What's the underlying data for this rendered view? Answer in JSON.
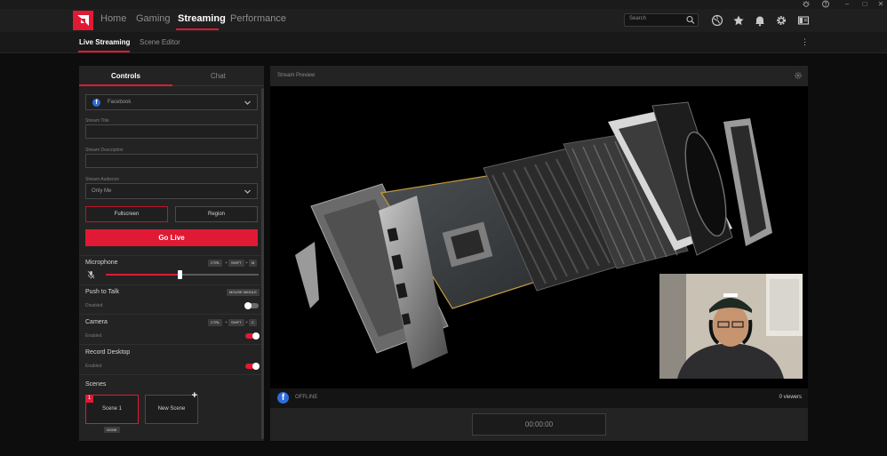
{
  "colors": {
    "accent": "#e01a34",
    "panel": "#232323",
    "background": "#0d0d0d",
    "facebook": "#2d6bd9"
  },
  "window": {
    "icons": [
      "bug-icon",
      "help-icon",
      "minimize-icon",
      "maximize-icon",
      "close-icon"
    ],
    "glyphs": {
      "minimize": "–",
      "maximize": "□",
      "close": "✕"
    }
  },
  "header": {
    "nav": [
      "Home",
      "Gaming",
      "Streaming",
      "Performance"
    ],
    "active": "Streaming",
    "search_placeholder": "Search",
    "icons": [
      "globe-icon",
      "star-icon",
      "bell-icon",
      "gear-icon",
      "panel-icon"
    ]
  },
  "subnav": {
    "tabs": [
      "Live Streaming",
      "Scene Editor"
    ],
    "active": "Live Streaming",
    "more": "⋮"
  },
  "left": {
    "tabs": [
      "Controls",
      "Chat"
    ],
    "platform": "Facebook",
    "platform_glyph": "f",
    "stream_title_label": "Stream Title",
    "stream_description_label": "Stream Description",
    "stream_audience_label": "Stream Audience",
    "stream_audience_value": "Only Me",
    "capture_buttons": [
      "Fullscreen",
      "Region"
    ],
    "go_live": "Go Live",
    "microphone": {
      "label": "Microphone",
      "keys": [
        "CTRL",
        "SHIFT",
        "M"
      ],
      "level": 0.48
    },
    "push_to_talk": {
      "label": "Push to Talk",
      "key": "MOUSE MIDDLE",
      "status": "Disabled",
      "on": false
    },
    "camera": {
      "label": "Camera",
      "keys": [
        "CTRL",
        "SHIFT",
        "C"
      ],
      "status": "Enabled",
      "on": true
    },
    "record_desktop": {
      "label": "Record Desktop",
      "status": "Enabled",
      "on": true
    },
    "key_separator": "+",
    "scenes": {
      "label": "Scenes",
      "items": [
        {
          "num": "1",
          "name": "Scene 1",
          "tag": "NONE"
        }
      ],
      "new_label": "New Scene",
      "new_glyph": "+"
    }
  },
  "preview": {
    "title": "Stream Preview",
    "status": "OFFLINE",
    "viewers": "0 viewers",
    "timer": "00:00:00"
  }
}
